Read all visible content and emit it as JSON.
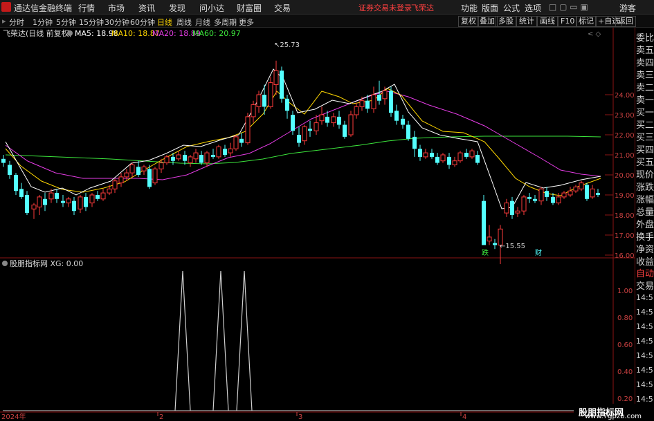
{
  "app": {
    "title": "通达信金融终端"
  },
  "menu": {
    "items": [
      "行情",
      "市场",
      "资讯",
      "发现",
      "问小达",
      "财富圈",
      "交易"
    ],
    "notice": "证券交易未登录",
    "stock": "飞荣达",
    "right": [
      "功能",
      "版面",
      "公式",
      "选项"
    ],
    "guest": "游客"
  },
  "toolbar": {
    "periods": [
      "分时",
      "1分钟",
      "5分钟",
      "15分钟",
      "30分钟",
      "60分钟",
      "日线",
      "周线",
      "月线",
      "多周期",
      "更多"
    ],
    "active_period": "日线",
    "buttons": [
      "复权",
      "叠加",
      "多股",
      "统计",
      "画线",
      "F10",
      "标记",
      "+自选",
      "返回"
    ]
  },
  "main_chart": {
    "title": "飞荣达(日线 前复权)",
    "ma": [
      {
        "label": "MA5: 18.98",
        "color": "#ffffff"
      },
      {
        "label": "MA10: 18.87",
        "color": "#ffd700"
      },
      {
        "label": "MA20: 18.89",
        "color": "#e63ce6"
      },
      {
        "label": "MA60: 20.97",
        "color": "#3ce63c"
      }
    ],
    "high_label": "25.73",
    "low_label": "15.55",
    "flag_fall": "跌",
    "flag_fin": "财",
    "y_ticks": [
      "24.00",
      "23.00",
      "22.00",
      "21.00",
      "20.00",
      "19.00",
      "18.00",
      "17.00",
      "16.00"
    ]
  },
  "indicator": {
    "title": "股朋指标网 XG: 0.00",
    "y_ticks": [
      "1.00",
      "0.80",
      "0.60",
      "0.40",
      "0.20"
    ]
  },
  "x_axis": {
    "labels": [
      "2024年",
      "2",
      "3",
      "4"
    ]
  },
  "side_panel": {
    "labels": [
      "委比",
      "卖五",
      "卖四",
      "卖三",
      "卖二",
      "卖一",
      "买一",
      "买二",
      "买三",
      "买四",
      "买五",
      "现价",
      "涨跌",
      "涨幅",
      "总量",
      "外盘",
      "换手",
      "净资",
      "收益"
    ],
    "lower": [
      "自动",
      "交易"
    ],
    "times": [
      "14:5",
      "14:5",
      "14:5",
      "14:5",
      "14:5",
      "14:5",
      "14:5",
      "14:5"
    ]
  },
  "colors": {
    "up": "#ff3b3b",
    "down": "#54ffff",
    "ma5": "#ffffff",
    "ma10": "#ffd700",
    "ma20": "#e63ce6",
    "ma60": "#3ce63c",
    "frame": "#8b1414"
  },
  "watermark": {
    "title": "股朋指标网",
    "url": "www.7gpzb.com"
  }
}
